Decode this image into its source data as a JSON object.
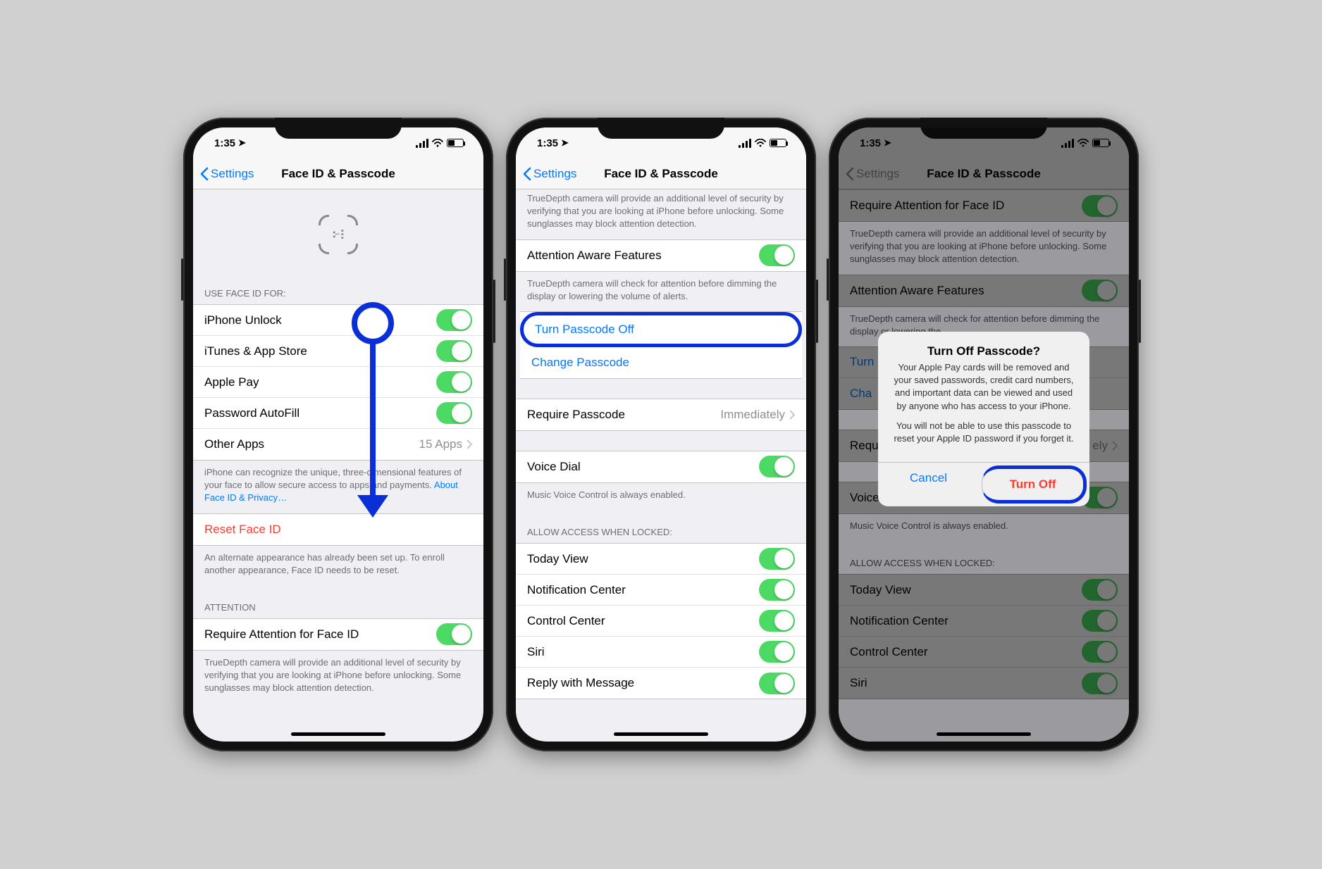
{
  "status": {
    "time": "1:35",
    "loc_glyph": "➤"
  },
  "nav": {
    "back": "Settings",
    "title": "Face ID & Passcode"
  },
  "s1": {
    "header_use": "USE FACE ID FOR:",
    "iphone_unlock": "iPhone Unlock",
    "itunes": "iTunes & App Store",
    "apple_pay": "Apple Pay",
    "autofill": "Password AutoFill",
    "other_apps": "Other Apps",
    "other_apps_detail": "15 Apps",
    "footer_face": "iPhone can recognize the unique, three-dimensional features of your face to allow secure access to apps and payments. ",
    "footer_face_link": "About Face ID & Privacy…",
    "reset": "Reset Face ID",
    "footer_alt": "An alternate appearance has already been set up. To enroll another appearance, Face ID needs to be reset.",
    "header_attention": "ATTENTION",
    "require_attention": "Require Attention for Face ID",
    "footer_req": "TrueDepth camera will provide an additional level of security by verifying that you are looking at iPhone before unlocking. Some sunglasses may block attention detection."
  },
  "s2": {
    "footer_req_partial": "TrueDepth camera will provide an additional level of security by verifying that you are looking at iPhone before unlocking. Some sunglasses may block attention detection.",
    "aware": "Attention Aware Features",
    "footer_aware": "TrueDepth camera will check for attention before dimming the display or lowering the volume of alerts.",
    "turn_off": "Turn Passcode Off",
    "change": "Change Passcode",
    "require_passcode": "Require Passcode",
    "require_passcode_val": "Immediately",
    "voice_dial": "Voice Dial",
    "footer_voice": "Music Voice Control is always enabled.",
    "header_allow": "ALLOW ACCESS WHEN LOCKED:",
    "today": "Today View",
    "notif": "Notification Center",
    "control": "Control Center",
    "siri": "Siri",
    "reply": "Reply with Message"
  },
  "s3": {
    "require_attention": "Require Attention for Face ID",
    "footer_req": "TrueDepth camera will provide an additional level of security by verifying that you are looking at iPhone before unlocking. Some sunglasses may block attention detection.",
    "aware": "Attention Aware Features",
    "footer_aware": "TrueDepth camera will check for attention before dimming the display or lowering the",
    "turn_short": "Turn",
    "change_short": "Cha",
    "require_short": "Requ",
    "require_val_short": "ely",
    "voice_dial": "Voice Dial",
    "footer_voice": "Music Voice Control is always enabled.",
    "header_allow": "ALLOW ACCESS WHEN LOCKED:",
    "today": "Today View",
    "notif": "Notification Center",
    "control": "Control Center",
    "siri": "Siri",
    "alert_title": "Turn Off Passcode?",
    "alert_msg1": "Your Apple Pay cards will be removed and your saved passwords, credit card numbers, and important data can be viewed and used by anyone who has access to your iPhone.",
    "alert_msg2": "You will not be able to use this passcode to reset your Apple ID password if you forget it.",
    "cancel": "Cancel",
    "turnoff": "Turn Off"
  }
}
